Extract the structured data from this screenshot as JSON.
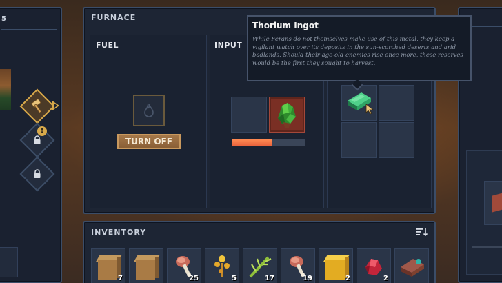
{
  "left_panel": {
    "partial_number": "5"
  },
  "furnace": {
    "title": "FURNACE",
    "fuel_label": "FUEL",
    "input_label": "INPUT",
    "turn_off_label": "TURN OFF",
    "progress": 0.55
  },
  "tooltip": {
    "title": "Thorium Ingot",
    "description": "While Ferans do not themselves make use of this metal, they keep a vigilant watch over its deposits in the sun-scorched deserts and arid badlands. Should their age-old enemies rise once more, these reserves would be the first they sought to harvest."
  },
  "inventory": {
    "title": "INVENTORY",
    "slots": [
      {
        "item": "sand-block",
        "count": "7"
      },
      {
        "item": "sand-block",
        "count": ""
      },
      {
        "item": "meat-drumstick",
        "count": "25"
      },
      {
        "item": "golden-plant",
        "count": "5"
      },
      {
        "item": "green-stalk",
        "count": "17"
      },
      {
        "item": "meat-drumstick",
        "count": "19"
      },
      {
        "item": "gold-block",
        "count": "2"
      },
      {
        "item": "red-crystal",
        "count": "2"
      },
      {
        "item": "copper-ore",
        "count": ""
      }
    ]
  },
  "colors": {
    "panel": "#1d2534",
    "border": "#3b4d68",
    "accent": "#d8a94a",
    "progress": "#e8603a",
    "slot_highlight": "#7a2f24"
  },
  "icons": [
    "hammer-icon",
    "lock-icon",
    "flame-icon",
    "sort-icon",
    "cursor-icon"
  ]
}
